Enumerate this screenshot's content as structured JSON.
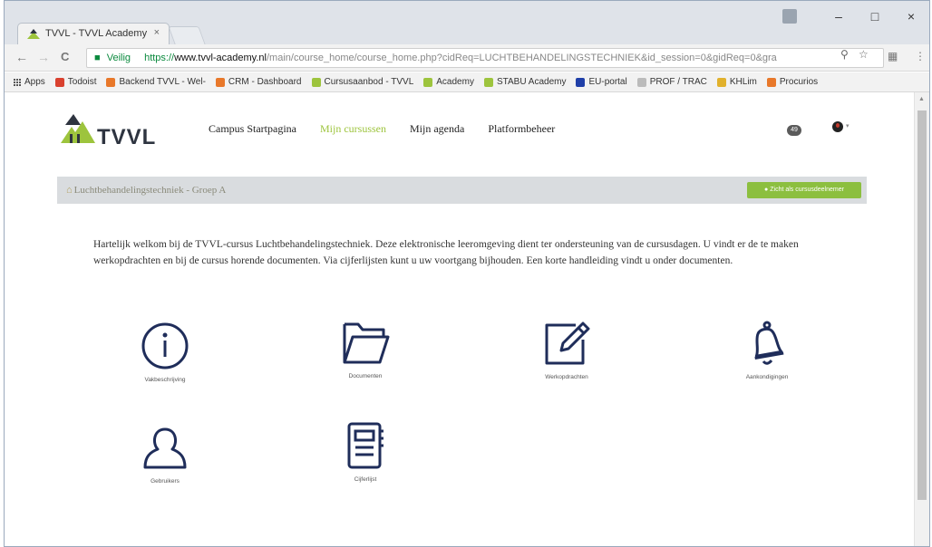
{
  "browser": {
    "tab_title": "TVVL - TVVL Academy",
    "tab_close": "×",
    "window_minimize": "–",
    "window_maximize": "□",
    "window_close": "×",
    "nav_back": "←",
    "nav_forward": "→",
    "nav_reload": "C",
    "secure_label": "Veilig",
    "url_protocol": "https://",
    "url_host": "www.tvvl-academy.nl",
    "url_path": "/main/course_home/course_home.php?cidReq=LUCHTBEHANDELINGSTECHNIEK&id_session=0&gidReq=0&gra",
    "bookmarks": [
      {
        "label": "Apps",
        "icon": "apps-grid-icon",
        "color": "#555555"
      },
      {
        "label": "Todoist",
        "icon": "todoist-icon",
        "color": "#d9412f"
      },
      {
        "label": "Backend TVVL - Wel-",
        "icon": "backend-icon",
        "color": "#e8782a"
      },
      {
        "label": "CRM - Dashboard",
        "icon": "crm-icon",
        "color": "#e8782a"
      },
      {
        "label": "Cursusaanbod - TVVL",
        "icon": "tvvl-icon",
        "color": "#9dc43d"
      },
      {
        "label": "Academy",
        "icon": "tvvl-icon",
        "color": "#9dc43d"
      },
      {
        "label": "STABU Academy",
        "icon": "stabu-icon",
        "color": "#9dc43d"
      },
      {
        "label": "EU-portal",
        "icon": "eu-icon",
        "color": "#1f3fa8"
      },
      {
        "label": "PROF / TRAC",
        "icon": "trac-icon",
        "color": "#bbbbbb"
      },
      {
        "label": "KHLim",
        "icon": "khlim-icon",
        "color": "#e1b12c"
      },
      {
        "label": "Procurios",
        "icon": "procurios-icon",
        "color": "#e8782a"
      }
    ]
  },
  "header": {
    "logo_text": "TVVL",
    "nav": [
      {
        "label": "Campus Startpagina",
        "active": false
      },
      {
        "label": "Mijn cursussen",
        "active": true
      },
      {
        "label": "Mijn agenda",
        "active": false
      },
      {
        "label": "Platformbeheer",
        "active": false
      }
    ],
    "message_count": "49"
  },
  "breadcrumb": {
    "course": "Luchtbehandelingstechniek - Groep A",
    "view_as_button": "Zicht als cursusdeelnemer"
  },
  "welcome_text": "Hartelijk welkom bij de TVVL-cursus Luchtbehandelingstechniek. Deze elektronische leeromgeving dient ter ondersteuning van de cursusdagen. U vindt er de te maken werkopdrachten en bij de cursus horende documenten. Via cijferlijsten kunt u uw voortgang bijhouden. Een korte handleiding vindt u onder documenten.",
  "tools": [
    {
      "label": "Vakbeschrijving",
      "icon": "info-icon"
    },
    {
      "label": "Documenten",
      "icon": "folder-icon"
    },
    {
      "label": "Werkopdrachten",
      "icon": "edit-icon"
    },
    {
      "label": "Aankondigingen",
      "icon": "bell-icon"
    },
    {
      "label": "Gebruikers",
      "icon": "user-icon"
    },
    {
      "label": "Cijferlijst",
      "icon": "notebook-icon"
    }
  ],
  "colors": {
    "accent_green": "#8cbf3f",
    "icon_navy": "#1f2d5a",
    "active_nav": "#9dc43d"
  }
}
